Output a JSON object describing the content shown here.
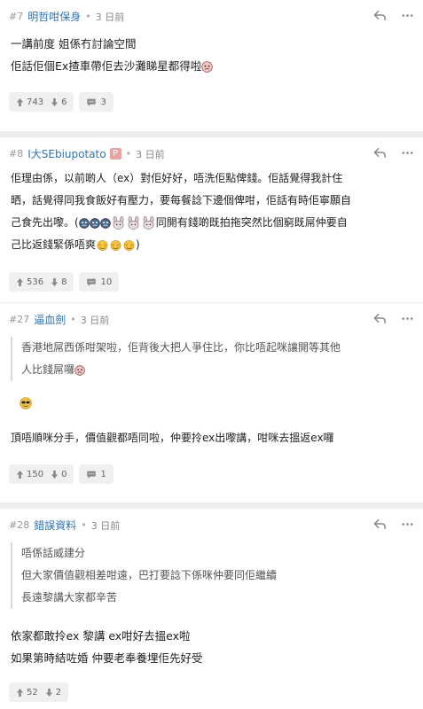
{
  "posts": [
    {
      "number": "#7",
      "username": "明哲咁保身",
      "time": "3 日前",
      "body": [
        "一講前度 姐係冇討論空間",
        "佢話佢個Ex揸車帶佢去沙灘睇星都得啦"
      ],
      "up": "743",
      "down": "6",
      "replies": "3"
    },
    {
      "number": "#8",
      "username": "I大SEbiupotato",
      "badge": "P",
      "time": "3 日前",
      "body": [
        "佢理由係，以前啲人（ex）對佢好好，唔洗佢點俾錢。佢話覺得我計住",
        "晒，話覺得同我食飯好有壓力，要每餐諗下邊個俾咁，佢話有時佢寧願自",
        "己食先出嚟。(",
        "同開有錢啲既拍拖突然比個窮既屌仲要自",
        "己比返錢緊係唔爽",
        ")"
      ],
      "up": "536",
      "down": "8",
      "replies": "10"
    },
    {
      "number": "#27",
      "username": "逼血劍",
      "time": "3 日前",
      "quote": [
        "香港地屌西係咁架啦，佢背後大把人爭住比，你比唔起咪讓開等其他",
        "人比錢屌囉"
      ],
      "body": [
        "頂唔順咪分手，價值觀都唔同啦，仲要拎ex出嚟講，咁咪去搵返ex囉"
      ],
      "up": "150",
      "down": "0",
      "replies": "1"
    },
    {
      "number": "#28",
      "username": "錯誤資料",
      "time": "3 日前",
      "quote": [
        "唔係話威建分",
        "但大家價值觀相差咁遠，巴打要諗下係咪仲要同佢繼續",
        "長遠黎講大家都辛苦"
      ],
      "body": [
        "依家都敢拎ex 黎講 ex咁好去搵ex啦",
        "如果第時結咗婚 仲要老奉養埋佢先好受"
      ],
      "up": "52",
      "down": "2"
    }
  ],
  "icons": [
    "reply-icon",
    "more-icon",
    "thumb-up-icon",
    "thumb-down-icon",
    "comment-icon",
    "angry-emoji-icon",
    "crying-emoji-icon",
    "bunny-emoji-icon",
    "sunglasses-emoji-icon"
  ]
}
